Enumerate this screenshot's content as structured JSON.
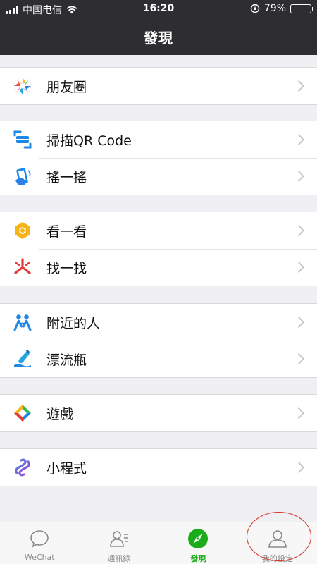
{
  "status_bar": {
    "carrier": "中国电信",
    "time": "16:20",
    "battery": "79%",
    "battery_level": 0.79
  },
  "nav": {
    "title": "發現"
  },
  "menu_groups": [
    {
      "items": [
        {
          "label": "朋友圈",
          "icon": "moments-icon"
        }
      ]
    },
    {
      "items": [
        {
          "label": "掃描QR Code",
          "icon": "scan-qr-icon"
        },
        {
          "label": "搖一搖",
          "icon": "shake-icon"
        }
      ]
    },
    {
      "items": [
        {
          "label": "看一看",
          "icon": "top-stories-icon"
        },
        {
          "label": "找一找",
          "icon": "search-icon"
        }
      ]
    },
    {
      "items": [
        {
          "label": "附近的人",
          "icon": "people-nearby-icon"
        },
        {
          "label": "漂流瓶",
          "icon": "drift-bottle-icon"
        }
      ]
    },
    {
      "items": [
        {
          "label": "遊戲",
          "icon": "games-icon"
        }
      ]
    },
    {
      "items": [
        {
          "label": "小程式",
          "icon": "mini-programs-icon"
        }
      ]
    }
  ],
  "tabbar": {
    "tabs": [
      {
        "label": "WeChat",
        "icon": "chat-bubble-icon",
        "active": false
      },
      {
        "label": "通訊錄",
        "icon": "contacts-icon",
        "active": false
      },
      {
        "label": "發現",
        "icon": "compass-icon",
        "active": true
      },
      {
        "label": "我的設定",
        "icon": "person-icon",
        "active": false
      }
    ]
  },
  "colors": {
    "nav_bg": "#2e2e31",
    "page_bg": "#efeff4",
    "active_tab": "#1aad19",
    "annotation": "#d8352a"
  }
}
